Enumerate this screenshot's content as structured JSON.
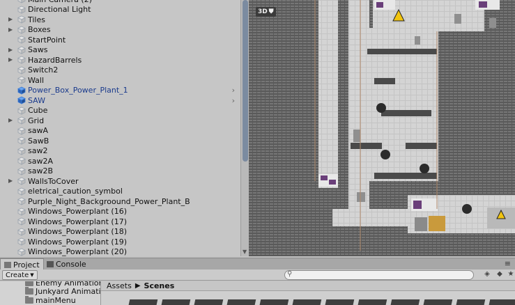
{
  "hierarchy": {
    "items": [
      {
        "label": "Main Camera (2)",
        "foldout": false,
        "prefab": false
      },
      {
        "label": "Directional Light",
        "foldout": false,
        "prefab": false
      },
      {
        "label": "Tiles",
        "foldout": true,
        "prefab": false
      },
      {
        "label": "Boxes",
        "foldout": true,
        "prefab": false
      },
      {
        "label": "StartPoint",
        "foldout": false,
        "prefab": false
      },
      {
        "label": "Saws",
        "foldout": true,
        "prefab": false
      },
      {
        "label": "HazardBarrels",
        "foldout": true,
        "prefab": false
      },
      {
        "label": "Switch2",
        "foldout": false,
        "prefab": false
      },
      {
        "label": "Wall",
        "foldout": false,
        "prefab": false
      },
      {
        "label": "Power_Box_Power_Plant_1",
        "foldout": false,
        "prefab": true
      },
      {
        "label": "SAW",
        "foldout": false,
        "prefab": true
      },
      {
        "label": "Cube",
        "foldout": false,
        "prefab": false
      },
      {
        "label": "Grid",
        "foldout": true,
        "prefab": false
      },
      {
        "label": "sawA",
        "foldout": false,
        "prefab": false
      },
      {
        "label": "SawB",
        "foldout": false,
        "prefab": false
      },
      {
        "label": "saw2",
        "foldout": false,
        "prefab": false
      },
      {
        "label": "saw2A",
        "foldout": false,
        "prefab": false
      },
      {
        "label": "saw2B",
        "foldout": false,
        "prefab": false
      },
      {
        "label": "WallsToCover",
        "foldout": true,
        "prefab": false
      },
      {
        "label": "eletrical_caution_symbol",
        "foldout": false,
        "prefab": false
      },
      {
        "label": "Purple_Night_Backgroound_Power_Plant_B",
        "foldout": false,
        "prefab": false
      },
      {
        "label": "Windows_Powerplant (16)",
        "foldout": false,
        "prefab": false
      },
      {
        "label": "Windows_Powerplant (17)",
        "foldout": false,
        "prefab": false
      },
      {
        "label": "Windows_Powerplant (18)",
        "foldout": false,
        "prefab": false
      },
      {
        "label": "Windows_Powerplant (19)",
        "foldout": false,
        "prefab": false
      },
      {
        "label": "Windows_Powerplant (20)",
        "foldout": false,
        "prefab": false
      }
    ]
  },
  "scene": {
    "mode_button": "3D",
    "bg_color": "#5d5d5d",
    "wall_color": "#d4d4d4"
  },
  "bottom": {
    "tabs": [
      {
        "label": "Project",
        "active": true
      },
      {
        "label": "Console",
        "active": false
      }
    ],
    "create_label": "Create",
    "search_value": "",
    "folders": [
      "Enemy Animation",
      "Junkyard Animation",
      "mainMenu"
    ],
    "breadcrumb": [
      "Assets",
      "Scenes"
    ]
  },
  "colors": {
    "prefab_text": "#1a3a8c",
    "cube_icon": "#9aa3ad",
    "prefab_cube": "#3a7ad6"
  }
}
